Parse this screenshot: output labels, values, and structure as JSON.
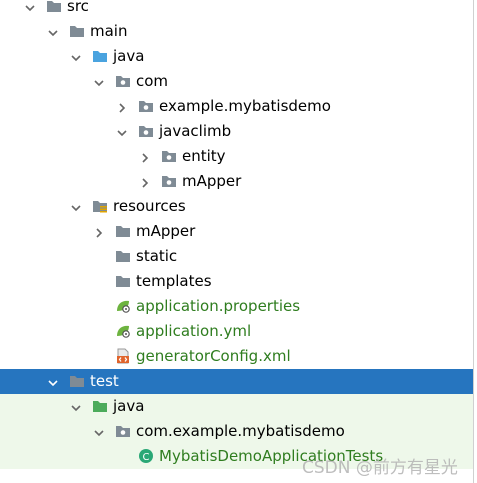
{
  "tree": {
    "rows": [
      {
        "label": "src",
        "indent": 0,
        "chevron": "down",
        "icon": "folder",
        "color": "normal"
      },
      {
        "label": "main",
        "indent": 1,
        "chevron": "down",
        "icon": "folder",
        "color": "normal"
      },
      {
        "label": "java",
        "indent": 2,
        "chevron": "down",
        "icon": "folder-source",
        "color": "normal"
      },
      {
        "label": "com",
        "indent": 3,
        "chevron": "down",
        "icon": "package",
        "color": "normal"
      },
      {
        "label": "example.mybatisdemo",
        "indent": 4,
        "chevron": "right",
        "icon": "package",
        "color": "normal"
      },
      {
        "label": "javaclimb",
        "indent": 4,
        "chevron": "down",
        "icon": "package",
        "color": "normal"
      },
      {
        "label": "entity",
        "indent": 5,
        "chevron": "right",
        "icon": "package",
        "color": "normal"
      },
      {
        "label": "mApper",
        "indent": 5,
        "chevron": "right",
        "icon": "package",
        "color": "normal"
      },
      {
        "label": "resources",
        "indent": 2,
        "chevron": "down",
        "icon": "folder-resources",
        "color": "normal"
      },
      {
        "label": "mApper",
        "indent": 3,
        "chevron": "right",
        "icon": "folder",
        "color": "normal"
      },
      {
        "label": "static",
        "indent": 3,
        "chevron": "none",
        "icon": "folder",
        "color": "normal"
      },
      {
        "label": "templates",
        "indent": 3,
        "chevron": "none",
        "icon": "folder",
        "color": "normal"
      },
      {
        "label": "application.properties",
        "indent": 3,
        "chevron": "none",
        "icon": "spring-config",
        "color": "green"
      },
      {
        "label": "application.yml",
        "indent": 3,
        "chevron": "none",
        "icon": "spring-config",
        "color": "green"
      },
      {
        "label": "generatorConfig.xml",
        "indent": 3,
        "chevron": "none",
        "icon": "xml-file",
        "color": "green"
      },
      {
        "label": "test",
        "indent": 1,
        "chevron": "down",
        "icon": "folder",
        "color": "normal",
        "selected": true
      },
      {
        "label": "java",
        "indent": 2,
        "chevron": "down",
        "icon": "folder-test",
        "color": "normal",
        "test": true
      },
      {
        "label": "com.example.mybatisdemo",
        "indent": 3,
        "chevron": "down",
        "icon": "package",
        "color": "normal",
        "test": true
      },
      {
        "label": "MybatisDemoApplicationTests",
        "indent": 4,
        "chevron": "none",
        "icon": "java-class",
        "color": "green",
        "test": true
      }
    ]
  },
  "watermark": "CSDN @前方有星光",
  "colors": {
    "selection": "#2675bf",
    "test_background": "#eef8ea",
    "vcs_added_text": "#2f7d1f",
    "folder": "#7f8b95",
    "source_folder": "#4aa3df"
  }
}
